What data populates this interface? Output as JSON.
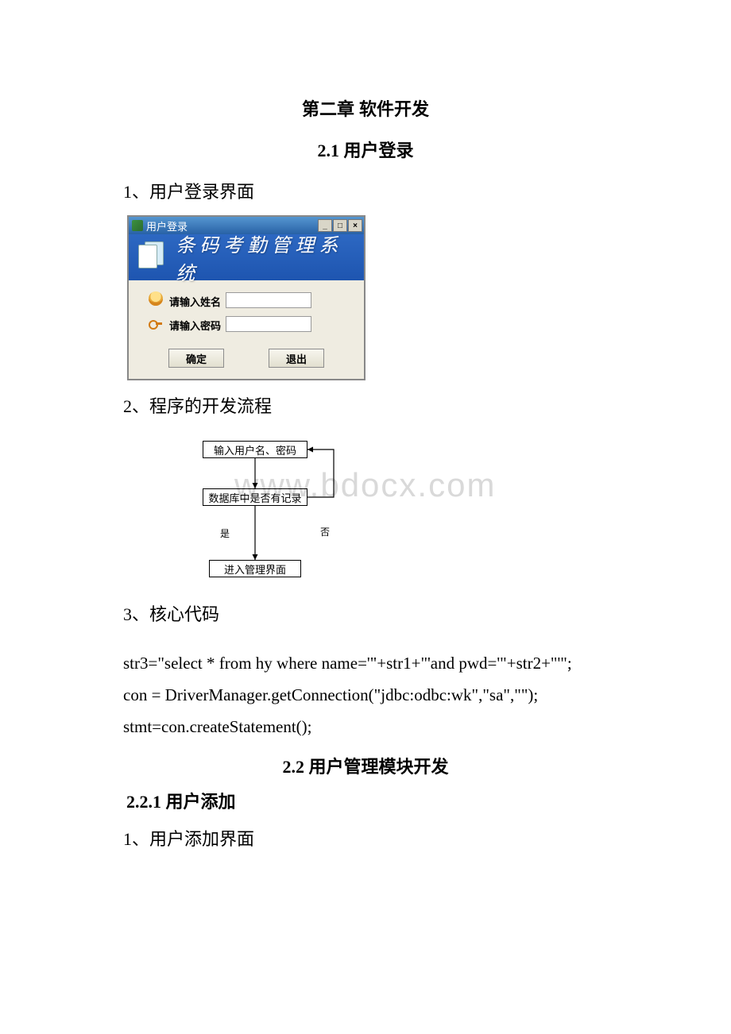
{
  "headings": {
    "chapter_title": "第二章 软件开发",
    "section_2_1": "2.1 用户登录",
    "section_2_2": "2.2 用户管理模块开发",
    "section_2_2_1": "2.2.1 用户添加"
  },
  "list_items": {
    "item_1": "1、用户登录界面",
    "item_2": "2、程序的开发流程",
    "item_3": "3、核心代码",
    "item_4": "1、用户添加界面"
  },
  "login_window": {
    "titlebar_text": "用户登录",
    "banner_text": "条码考勤管理系统",
    "label_name": "请输入姓名",
    "label_pwd": "请输入密码",
    "name_value": "",
    "pwd_value": "",
    "btn_ok": "确定",
    "btn_exit": "退出",
    "winbtn_min": "_",
    "winbtn_max": "□",
    "winbtn_close": "×"
  },
  "flowchart": {
    "box1": "输入用户名、密码",
    "box2": "数据库中是否有记录",
    "box3": "进入管理界面",
    "label_yes": "是",
    "label_no": "否"
  },
  "watermark": "www.bdocx.com",
  "code": {
    "line1": " str3=\"select * from hy where name='\"+str1+\"'and pwd='\"+str2+\"'\";",
    "line2": "con = DriverManager.getConnection(\"jdbc:odbc:wk\",\"sa\",\"\");",
    "line3": "stmt=con.createStatement();"
  }
}
